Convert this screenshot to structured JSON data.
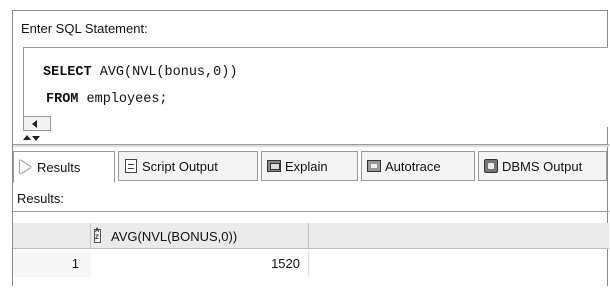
{
  "editor": {
    "label": "Enter SQL Statement:",
    "line1_keyword": "SELECT",
    "line1_rest": " AVG(NVL(bonus,0))",
    "line2_keyword": "FROM",
    "line2_rest": " employees;"
  },
  "tabs": [
    {
      "label": "Results",
      "icon": "play-icon",
      "active": true
    },
    {
      "label": "Script Output",
      "icon": "script-icon",
      "active": false
    },
    {
      "label": "Explain",
      "icon": "explain-icon",
      "active": false
    },
    {
      "label": "Autotrace",
      "icon": "autotrace-icon",
      "active": false
    },
    {
      "label": "DBMS Output",
      "icon": "dbms-output-icon",
      "active": false
    }
  ],
  "results": {
    "label": "Results:",
    "columns": [
      "AVG(NVL(BONUS,0))"
    ],
    "rows": [
      {
        "rownum": "1",
        "values": [
          "1520"
        ]
      }
    ]
  }
}
